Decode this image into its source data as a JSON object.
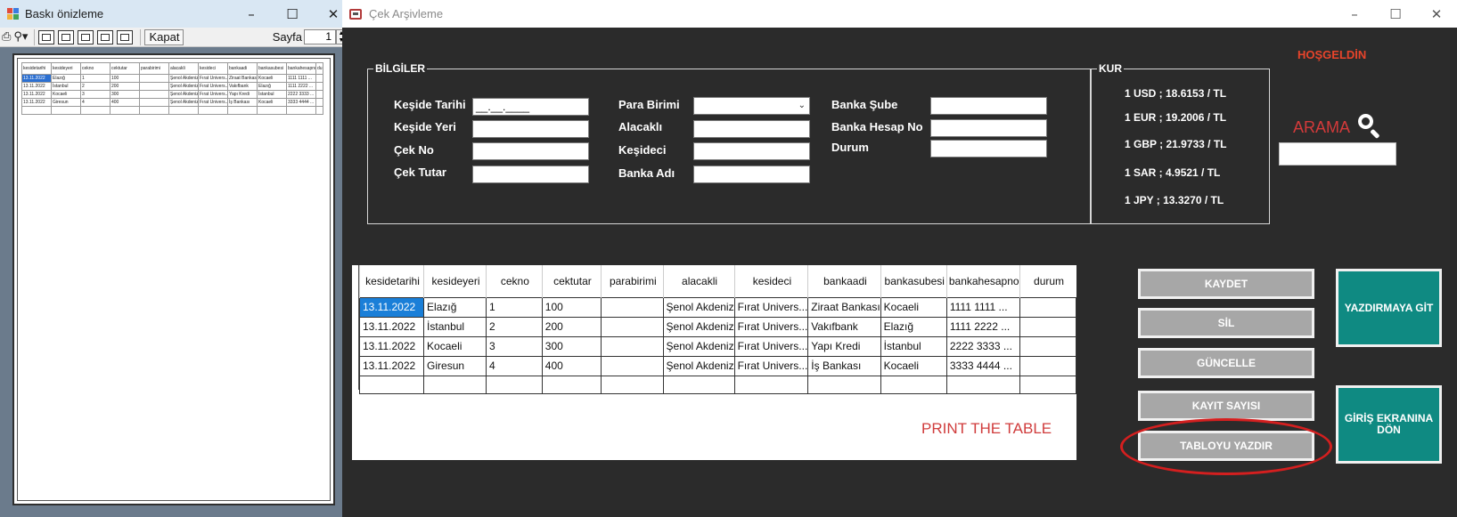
{
  "preview": {
    "title": "Baskı önizleme",
    "close_label": "Kapat",
    "page_label": "Sayfa",
    "page_value": "1",
    "table": {
      "headers": [
        "kesidetarihi",
        "kesideyeri",
        "cekno",
        "cektutar",
        "parabirimi",
        "alacakli",
        "kesideci",
        "bankaadi",
        "bankasubesi",
        "bankahesapno",
        "du"
      ],
      "rows": [
        [
          "13.11.2022",
          "Elazığ",
          "1",
          "100",
          "",
          "Şenol Akdeniz",
          "Fırat Univers...",
          "Ziraat Bankası",
          "Kocaeli",
          "1111 1111 ...",
          ""
        ],
        [
          "13.11.2022",
          "İstanbul",
          "2",
          "200",
          "",
          "Şenol Akdeniz",
          "Fırat Univers...",
          "Vakıfbank",
          "Elazığ",
          "1111 2222 ...",
          ""
        ],
        [
          "13.11.2022",
          "Kocaeli",
          "3",
          "300",
          "",
          "Şenol Akdeniz",
          "Fırat Univers...",
          "Yapı Kredi",
          "İstanbul",
          "2222 3333 ...",
          ""
        ],
        [
          "13.11.2022",
          "Giresun",
          "4",
          "400",
          "",
          "Şenol Akdeniz",
          "Fırat Univers...",
          "İş Bankası",
          "Kocaeli",
          "3333 4444 ...",
          ""
        ]
      ]
    }
  },
  "main": {
    "title": "Çek Arşivleme",
    "welcome": "HOŞGELDİN",
    "search_label": "ARAMA",
    "search_value": "",
    "bilgiler": {
      "title": "BİLGİLER",
      "labels": {
        "keside_tarihi": "Keşide Tarihi",
        "keside_yeri": "Keşide Yeri",
        "cek_no": "Çek No",
        "cek_tutar": "Çek Tutar",
        "para_birimi": "Para Birimi",
        "alacakli": "Alacaklı",
        "kesideci": "Keşideci",
        "banka_adi": "Banka Adı",
        "banka_sube": "Banka Şube",
        "banka_hesap_no": "Banka Hesap No",
        "durum": "Durum"
      },
      "values": {
        "keside_tarihi": "__.__.____",
        "keside_yeri": "",
        "cek_no": "",
        "cek_tutar": "",
        "para_birimi": "",
        "alacakli": "",
        "kesideci": "",
        "banka_adi": "",
        "banka_sube": "",
        "banka_hesap_no": "",
        "durum": ""
      }
    },
    "kur": {
      "title": "KUR",
      "lines": [
        "1 USD ; 18.6153 / TL",
        "1 EUR ; 19.2006 / TL",
        "1 GBP ; 21.9733 / TL",
        "1 SAR ; 4.9521 / TL",
        "1 JPY ; 13.3270 / TL"
      ]
    },
    "grid": {
      "headers": [
        "kesidetarihi",
        "kesideyeri",
        "cekno",
        "cektutar",
        "parabirimi",
        "alacakli",
        "kesideci",
        "bankaadi",
        "bankasubesi",
        "bankahesapno",
        "durum"
      ],
      "rows": [
        [
          "13.11.2022",
          "Elazığ",
          "1",
          "100",
          "",
          "Şenol Akdeniz",
          "Fırat Univers...",
          "Ziraat Bankası",
          "Kocaeli",
          "1111 1111 ...",
          ""
        ],
        [
          "13.11.2022",
          "İstanbul",
          "2",
          "200",
          "",
          "Şenol Akdeniz",
          "Fırat Univers...",
          "Vakıfbank",
          "Elazığ",
          "1111 2222 ...",
          ""
        ],
        [
          "13.11.2022",
          "Kocaeli",
          "3",
          "300",
          "",
          "Şenol Akdeniz",
          "Fırat Univers...",
          "Yapı Kredi",
          "İstanbul",
          "2222 3333 ...",
          ""
        ],
        [
          "13.11.2022",
          "Giresun",
          "4",
          "400",
          "",
          "Şenol Akdeniz",
          "Fırat Univers...",
          "İş Bankası",
          "Kocaeli",
          "3333 4444 ...",
          ""
        ]
      ]
    },
    "annotation": "PRINT THE TABLE",
    "buttons": {
      "kaydet": "KAYDET",
      "sil": "SİL",
      "guncelle": "GÜNCELLE",
      "kayit_sayisi": "KAYIT SAYISI",
      "tabloyu_yazdir": "TABLOYU YAZDIR",
      "yazdirmaya_git": "YAZDIRMAYA GİT",
      "giris_ekranina_don": "GİRİŞ EKRANINA DÖN"
    }
  },
  "colors": {
    "form_background": "#2b2b2b",
    "teal_button": "#0f8a82",
    "gray_button": "#a7a7a7",
    "accent_red": "#d41f1f",
    "selection_blue": "#1a7fd8"
  }
}
